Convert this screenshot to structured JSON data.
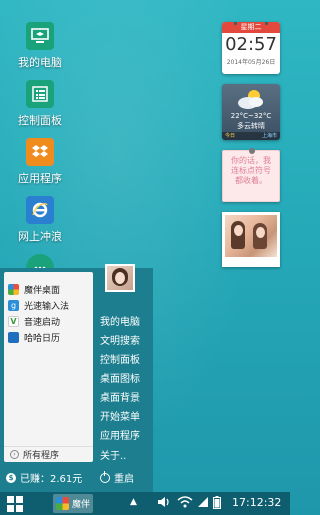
{
  "desktop_icons": [
    {
      "label": "我的电脑",
      "icon": "computer-icon",
      "color": "#1aa37a"
    },
    {
      "label": "控制面板",
      "icon": "control-panel-icon",
      "color": "#1aa37a"
    },
    {
      "label": "应用程序",
      "icon": "dropbox-icon",
      "color": "#f08c1e"
    },
    {
      "label": "网上冲浪",
      "icon": "ie-browser-icon",
      "color": "#2b7fd0"
    }
  ],
  "widgets": {
    "calendar": {
      "weekday": "星期二",
      "time": "02:57",
      "date": "2014年05月26日"
    },
    "weather": {
      "temp": "22°C~32°C",
      "condition": "多云转晴",
      "day": "今日",
      "city": "上海市"
    },
    "note": {
      "text": "你的话，我连标点符号都收着。"
    }
  },
  "start_menu": {
    "apps": [
      {
        "label": "魔伴桌面",
        "icon": "mobao-desktop-icon",
        "color": "#e94e3d"
      },
      {
        "label": "光速输入法",
        "icon": "input-method-icon",
        "color": "#2a8fd8"
      },
      {
        "label": "音速启动",
        "icon": "launcher-icon",
        "color": "#3a3a3a"
      },
      {
        "label": "哈哈日历",
        "icon": "calendar-app-icon",
        "color": "#1f6fbf"
      }
    ],
    "all_programs": "所有程序",
    "links": [
      "我的电脑",
      "文明搜索",
      "控制面板",
      "桌面图标",
      "桌面背景",
      "开始菜单",
      "应用程序",
      "关于.."
    ],
    "earned": "已赚：2.61元",
    "restart": "重启"
  },
  "taskbar": {
    "active_app": "魔伴",
    "clock": "17:12:32",
    "tray_icons": [
      "volume-icon",
      "wifi-icon",
      "signal-icon",
      "battery-icon"
    ]
  },
  "colors": {
    "wallpaper": "#25a9b8",
    "start_panel": "#1c7e8e",
    "taskbar": "#0f5e70"
  }
}
